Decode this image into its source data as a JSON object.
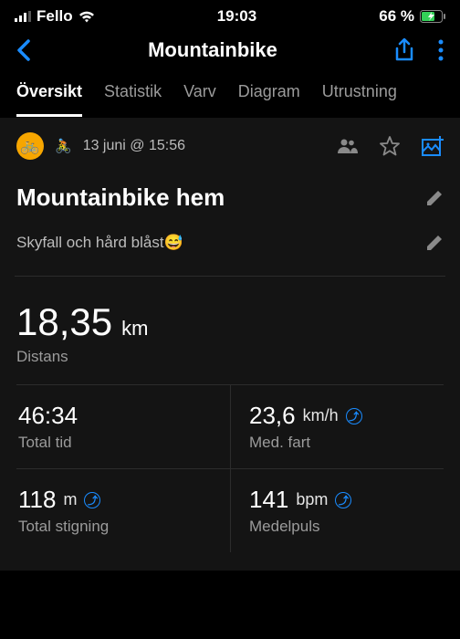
{
  "status": {
    "carrier": "Fello",
    "time": "19:03",
    "battery": "66 %"
  },
  "nav": {
    "title": "Mountainbike"
  },
  "tabs": [
    "Översikt",
    "Statistik",
    "Varv",
    "Diagram",
    "Utrustning"
  ],
  "activeTab": 0,
  "meta": {
    "datetime": "13 juni @ 15:56"
  },
  "activity": {
    "title": "Mountainbike hem",
    "note": "Skyfall och hård blåst😅"
  },
  "distance": {
    "value": "18,35",
    "unit": "km",
    "label": "Distans"
  },
  "stats": [
    {
      "value": "46:34",
      "unit": "",
      "label": "Total tid",
      "info": false
    },
    {
      "value": "23,6",
      "unit": "km/h",
      "label": "Med. fart",
      "info": true
    },
    {
      "value": "118",
      "unit": "m",
      "label": "Total stigning",
      "info": true
    },
    {
      "value": "141",
      "unit": "bpm",
      "label": "Medelpuls",
      "info": true
    }
  ]
}
